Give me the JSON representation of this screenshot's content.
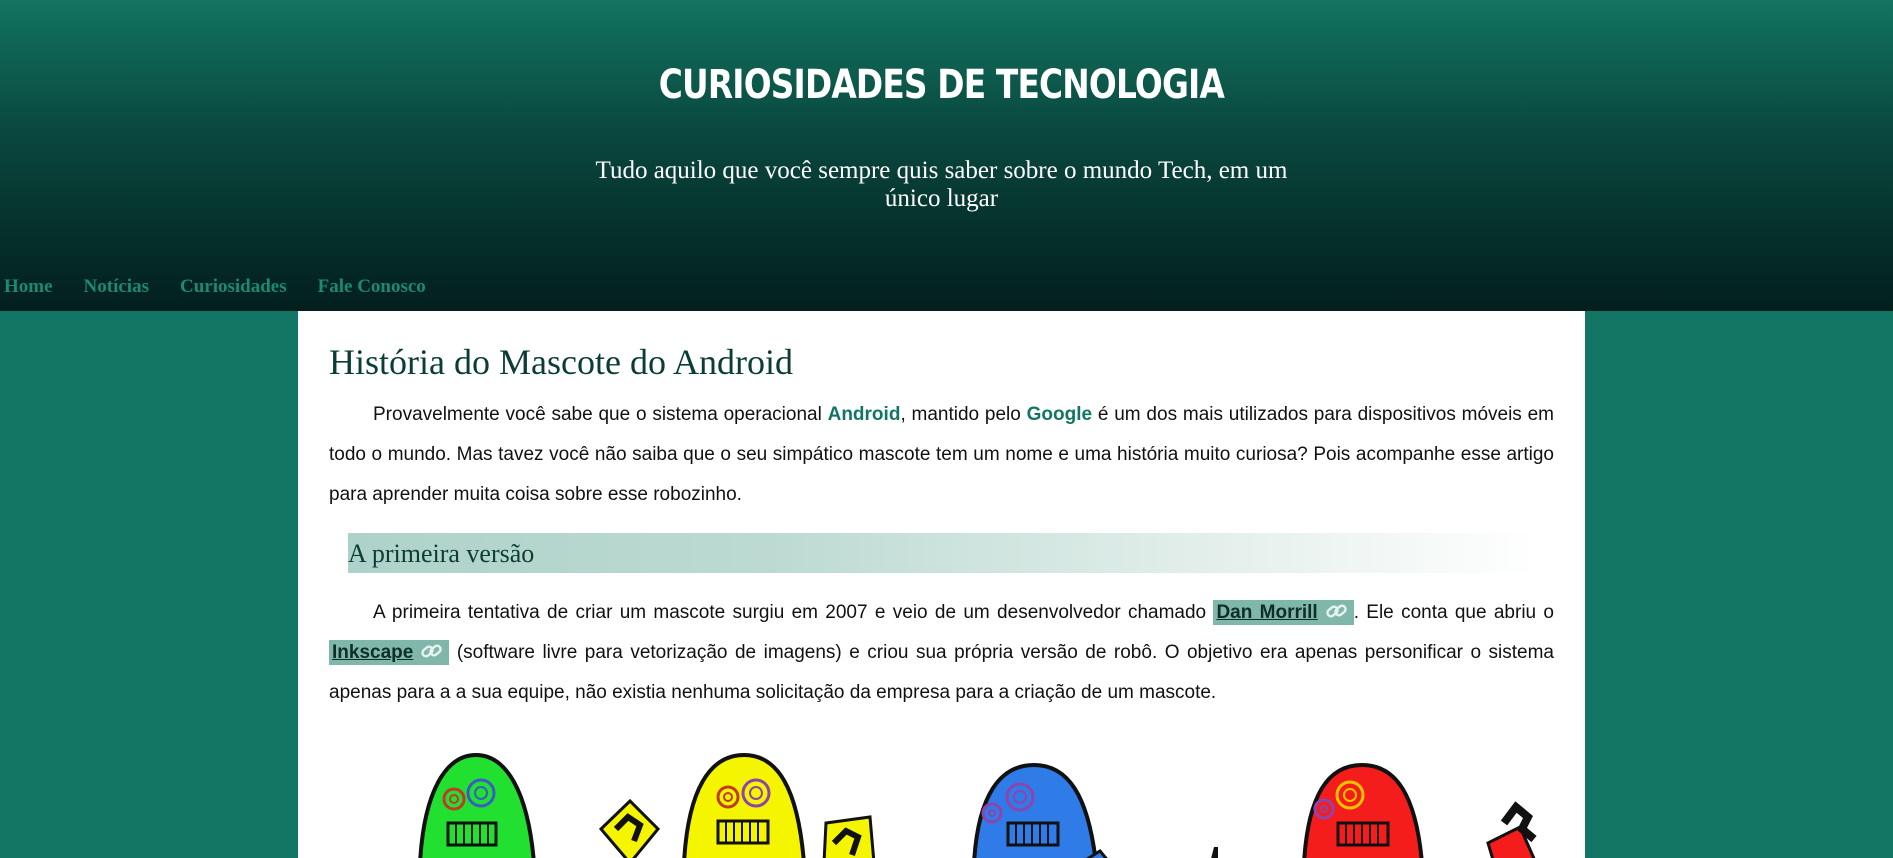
{
  "header": {
    "title": "CURIOSIDADES DE TECNOLOGIA",
    "subtitle": "Tudo aquilo que você sempre quis saber sobre o mundo Tech, em um único lugar"
  },
  "nav": {
    "items": [
      {
        "label": "Home"
      },
      {
        "label": "Notícias"
      },
      {
        "label": "Curiosidades"
      },
      {
        "label": "Fale Conosco"
      }
    ]
  },
  "article": {
    "title": "História do Mascote do Android",
    "intro": {
      "part1": "Provavelmente você sabe que o sistema operacional ",
      "kw1": "Android",
      "part2": ", mantido pelo ",
      "kw2": "Google",
      "part3": " é um dos mais utilizados para dispositivos móveis em todo o mundo. Mas tavez você não saiba que o seu simpático mascote tem um nome e uma história muito curiosa? Pois acompanhe esse artigo para aprender muita coisa sobre esse robozinho."
    },
    "section1": {
      "heading": "A primeira versão",
      "part1": "A primeira tentativa de criar um mascote surgiu em 2007 e veio de um desenvolvedor chamado ",
      "link1": "Dan Morrill",
      "part2": ". Ele conta que abriu o ",
      "link2": "Inkscape",
      "part3": " (software livre para vetorização de imagens) e criou sua própria versão de robô. O objetivo era apenas personificar o sistema apenas para a a sua equipe, não existia nenhuma solicitação da empresa para a criação de um mascote."
    }
  },
  "colors": {
    "page_bg": "#137563",
    "header_dark": "#031f1d",
    "link_green": "#137563",
    "link_box_bg": "#7fb8aa",
    "mascot_green": "#22e030",
    "mascot_yellow": "#f5f500",
    "mascot_blue": "#2f7be8",
    "mascot_red": "#f51c1c"
  },
  "image": {
    "icon": "android-mascot-robots-illustration"
  }
}
